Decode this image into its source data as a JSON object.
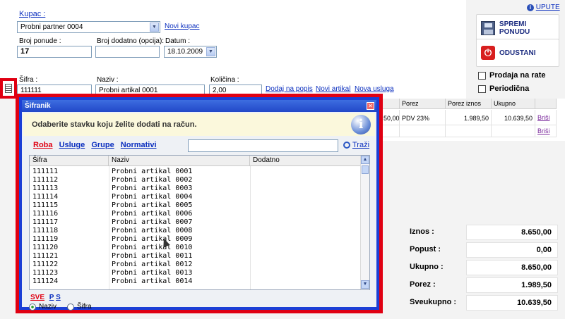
{
  "header": {
    "upute": "UPUTE",
    "kupac_label": "Kupac :",
    "kupac_value": "Probni partner 0004",
    "novi_kupac": "Novi kupac",
    "broj_ponude_label": "Broj ponude :",
    "broj_ponude_value": "17",
    "broj_dodatno_label": "Broj dodatno (opcija):",
    "broj_dodatno_value": "",
    "datum_label": "Datum :",
    "datum_value": "18.10.2009"
  },
  "actions": {
    "spremi": "SPREMI PONUDU",
    "odustani": "ODUSTANI",
    "prodaja_na_rate": "Prodaja na rate",
    "periodicna": "Periodična"
  },
  "item_entry": {
    "sifra_label": "Šifra :",
    "sifra_value": "111111",
    "naziv_label": "Naziv :",
    "naziv_value": "Probni artikal 0001",
    "kolicina_label": "Količina :",
    "kolicina_value": "2,00",
    "dodaj": "Dodaj na popis",
    "novi_artikal": "Novi artikal",
    "nova_usluga": "Nova usluga"
  },
  "grid": {
    "headers": [
      "Porez",
      "Porez iznos",
      "Ukupno"
    ],
    "row1": {
      "prev": "50,00",
      "porez": "PDV 23%",
      "porez_iznos": "1.989,50",
      "ukupno": "10.639,50",
      "brisi": "Briši"
    },
    "row2": {
      "brisi": "Briši"
    }
  },
  "summary": [
    {
      "label": "Iznos :",
      "value": "8.650,00"
    },
    {
      "label": "Popust :",
      "value": "0,00"
    },
    {
      "label": "Ukupno :",
      "value": "8.650,00"
    },
    {
      "label": "Porez :",
      "value": "1.989,50"
    },
    {
      "label": "Sveukupno :",
      "value": "10.639,50"
    }
  ],
  "dialog": {
    "title": "Šifranik",
    "message": "Odaberite stavku koju želite dodati na račun.",
    "tabs": [
      "Roba",
      "Usluge",
      "Grupe",
      "Normativi"
    ],
    "search_value": "",
    "search_button": "Traži",
    "columns": [
      "Šifra",
      "Naziv",
      "Dodatno"
    ],
    "rows": [
      {
        "sifra": "111111",
        "naziv": "Probni artikal 0001"
      },
      {
        "sifra": "111112",
        "naziv": "Probni artikal 0002"
      },
      {
        "sifra": "111113",
        "naziv": "Probni artikal 0003"
      },
      {
        "sifra": "111114",
        "naziv": "Probni artikal 0004"
      },
      {
        "sifra": "111115",
        "naziv": "Probni artikal 0005"
      },
      {
        "sifra": "111116",
        "naziv": "Probni artikal 0006"
      },
      {
        "sifra": "111117",
        "naziv": "Probni artikal 0007"
      },
      {
        "sifra": "111118",
        "naziv": "Probni artikal 0008"
      },
      {
        "sifra": "111119",
        "naziv": "Probni artikal 0009"
      },
      {
        "sifra": "111120",
        "naziv": "Probni artikal 0010"
      },
      {
        "sifra": "111121",
        "naziv": "Probni artikal 0011"
      },
      {
        "sifra": "111122",
        "naziv": "Probni artikal 0012"
      },
      {
        "sifra": "111123",
        "naziv": "Probni artikal 0013"
      },
      {
        "sifra": "111124",
        "naziv": "Probni artikal 0014"
      }
    ],
    "filter_sve": "SVE",
    "filter_p": "P",
    "filter_s": "S",
    "radio_naziv": "Naziv",
    "radio_sifra": "Šifra"
  },
  "colors": {
    "highlight_red": "#e00012",
    "dialog_blue": "#1b3fd6",
    "link_blue": "#0b2fbf"
  }
}
